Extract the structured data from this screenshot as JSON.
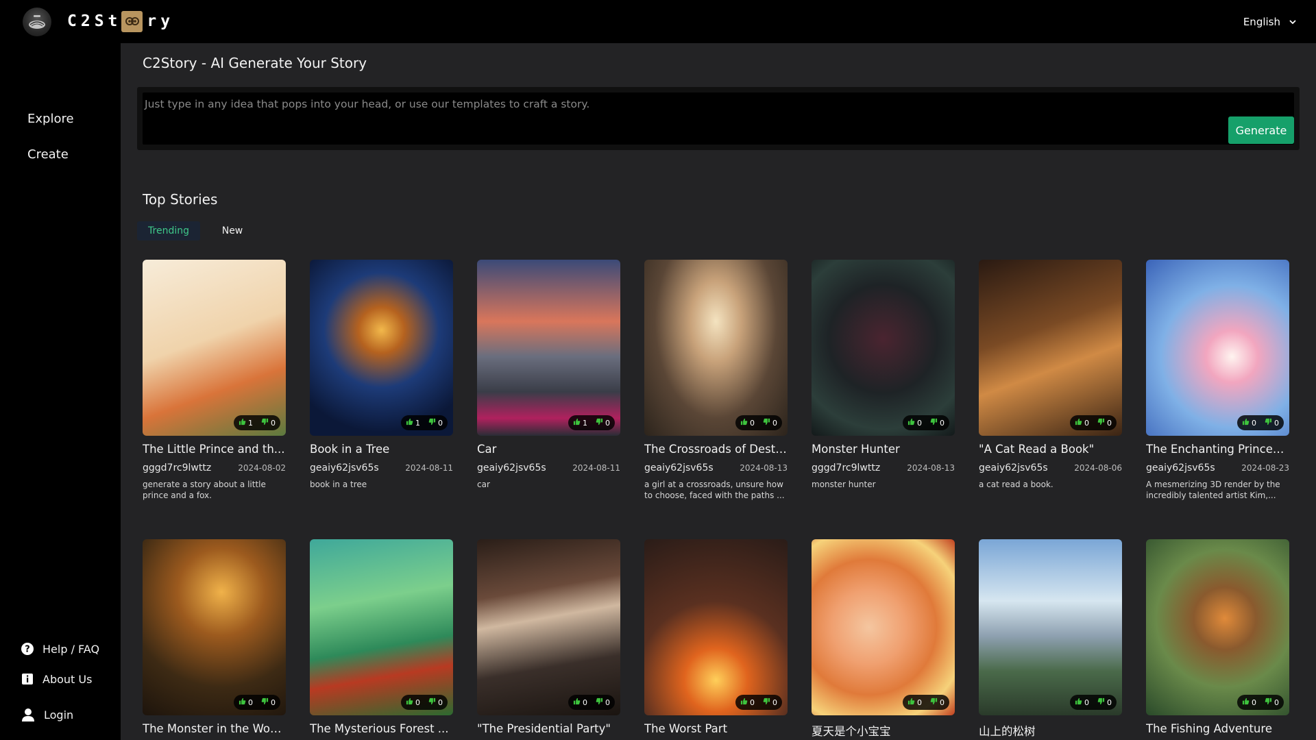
{
  "header": {
    "brand": "C2St",
    "brand_tail": "ry",
    "language": "English"
  },
  "sidebar": {
    "nav": [
      {
        "label": "Explore",
        "icon": "explore"
      },
      {
        "label": "Create",
        "icon": "create"
      }
    ],
    "footer": [
      {
        "label": "Help / FAQ",
        "icon": "help-icon"
      },
      {
        "label": "About Us",
        "icon": "info-icon"
      },
      {
        "label": "Login",
        "icon": "user-icon"
      }
    ]
  },
  "main": {
    "title": "C2Story - AI Generate Your Story",
    "prompt_placeholder": "Just type in any idea that pops into your head, or use our templates to craft a story.",
    "generate_label": "Generate",
    "section_title": "Top Stories",
    "tabs": [
      {
        "label": "Trending",
        "active": true
      },
      {
        "label": "New",
        "active": false
      }
    ]
  },
  "stories": [
    {
      "title": "The Little Prince and th...",
      "author": "gggd7rc9lwttz",
      "date": "2024-08-02",
      "desc": "generate a story about a little prince and a fox.",
      "likes": "1",
      "dislikes": "0"
    },
    {
      "title": "Book in a Tree",
      "author": "geaiy62jsv65s",
      "date": "2024-08-11",
      "desc": "book in a tree",
      "likes": "1",
      "dislikes": "0"
    },
    {
      "title": "Car",
      "author": "geaiy62jsv65s",
      "date": "2024-08-11",
      "desc": "car",
      "likes": "1",
      "dislikes": "0"
    },
    {
      "title": "The Crossroads of Desti...",
      "author": "geaiy62jsv65s",
      "date": "2024-08-13",
      "desc": "a girl at a crossroads, unsure how to choose, faced with the paths ...",
      "likes": "0",
      "dislikes": "0"
    },
    {
      "title": "Monster Hunter",
      "author": "gggd7rc9lwttz",
      "date": "2024-08-13",
      "desc": "monster hunter",
      "likes": "0",
      "dislikes": "0"
    },
    {
      "title": "\"A Cat Read a Book\"",
      "author": "geaiy62jsv65s",
      "date": "2024-08-06",
      "desc": "a cat read a book.",
      "likes": "0",
      "dislikes": "0"
    },
    {
      "title": "The Enchanting Princes...",
      "author": "geaiy62jsv65s",
      "date": "2024-08-23",
      "desc": "A mesmerizing 3D render by the incredibly talented artist Kim,...",
      "likes": "0",
      "dislikes": "0"
    },
    {
      "title": "The Monster in the Woo...",
      "likes": "0",
      "dislikes": "0"
    },
    {
      "title": "The Mysterious Forest ...",
      "likes": "0",
      "dislikes": "0"
    },
    {
      "title": "\"The Presidential Party\"",
      "likes": "0",
      "dislikes": "0"
    },
    {
      "title": "The Worst Part",
      "likes": "0",
      "dislikes": "0"
    },
    {
      "title": "夏天是个小宝宝",
      "likes": "0",
      "dislikes": "0"
    },
    {
      "title": "山上的松树",
      "likes": "0",
      "dislikes": "0"
    },
    {
      "title": "The Fishing Adventure",
      "likes": "0",
      "dislikes": "0"
    }
  ],
  "colors": {
    "accent": "#16a06a",
    "tab_active_text": "#3fc88a",
    "thumb_up": "#3ec43e",
    "thumb_down": "#3ec43e"
  }
}
